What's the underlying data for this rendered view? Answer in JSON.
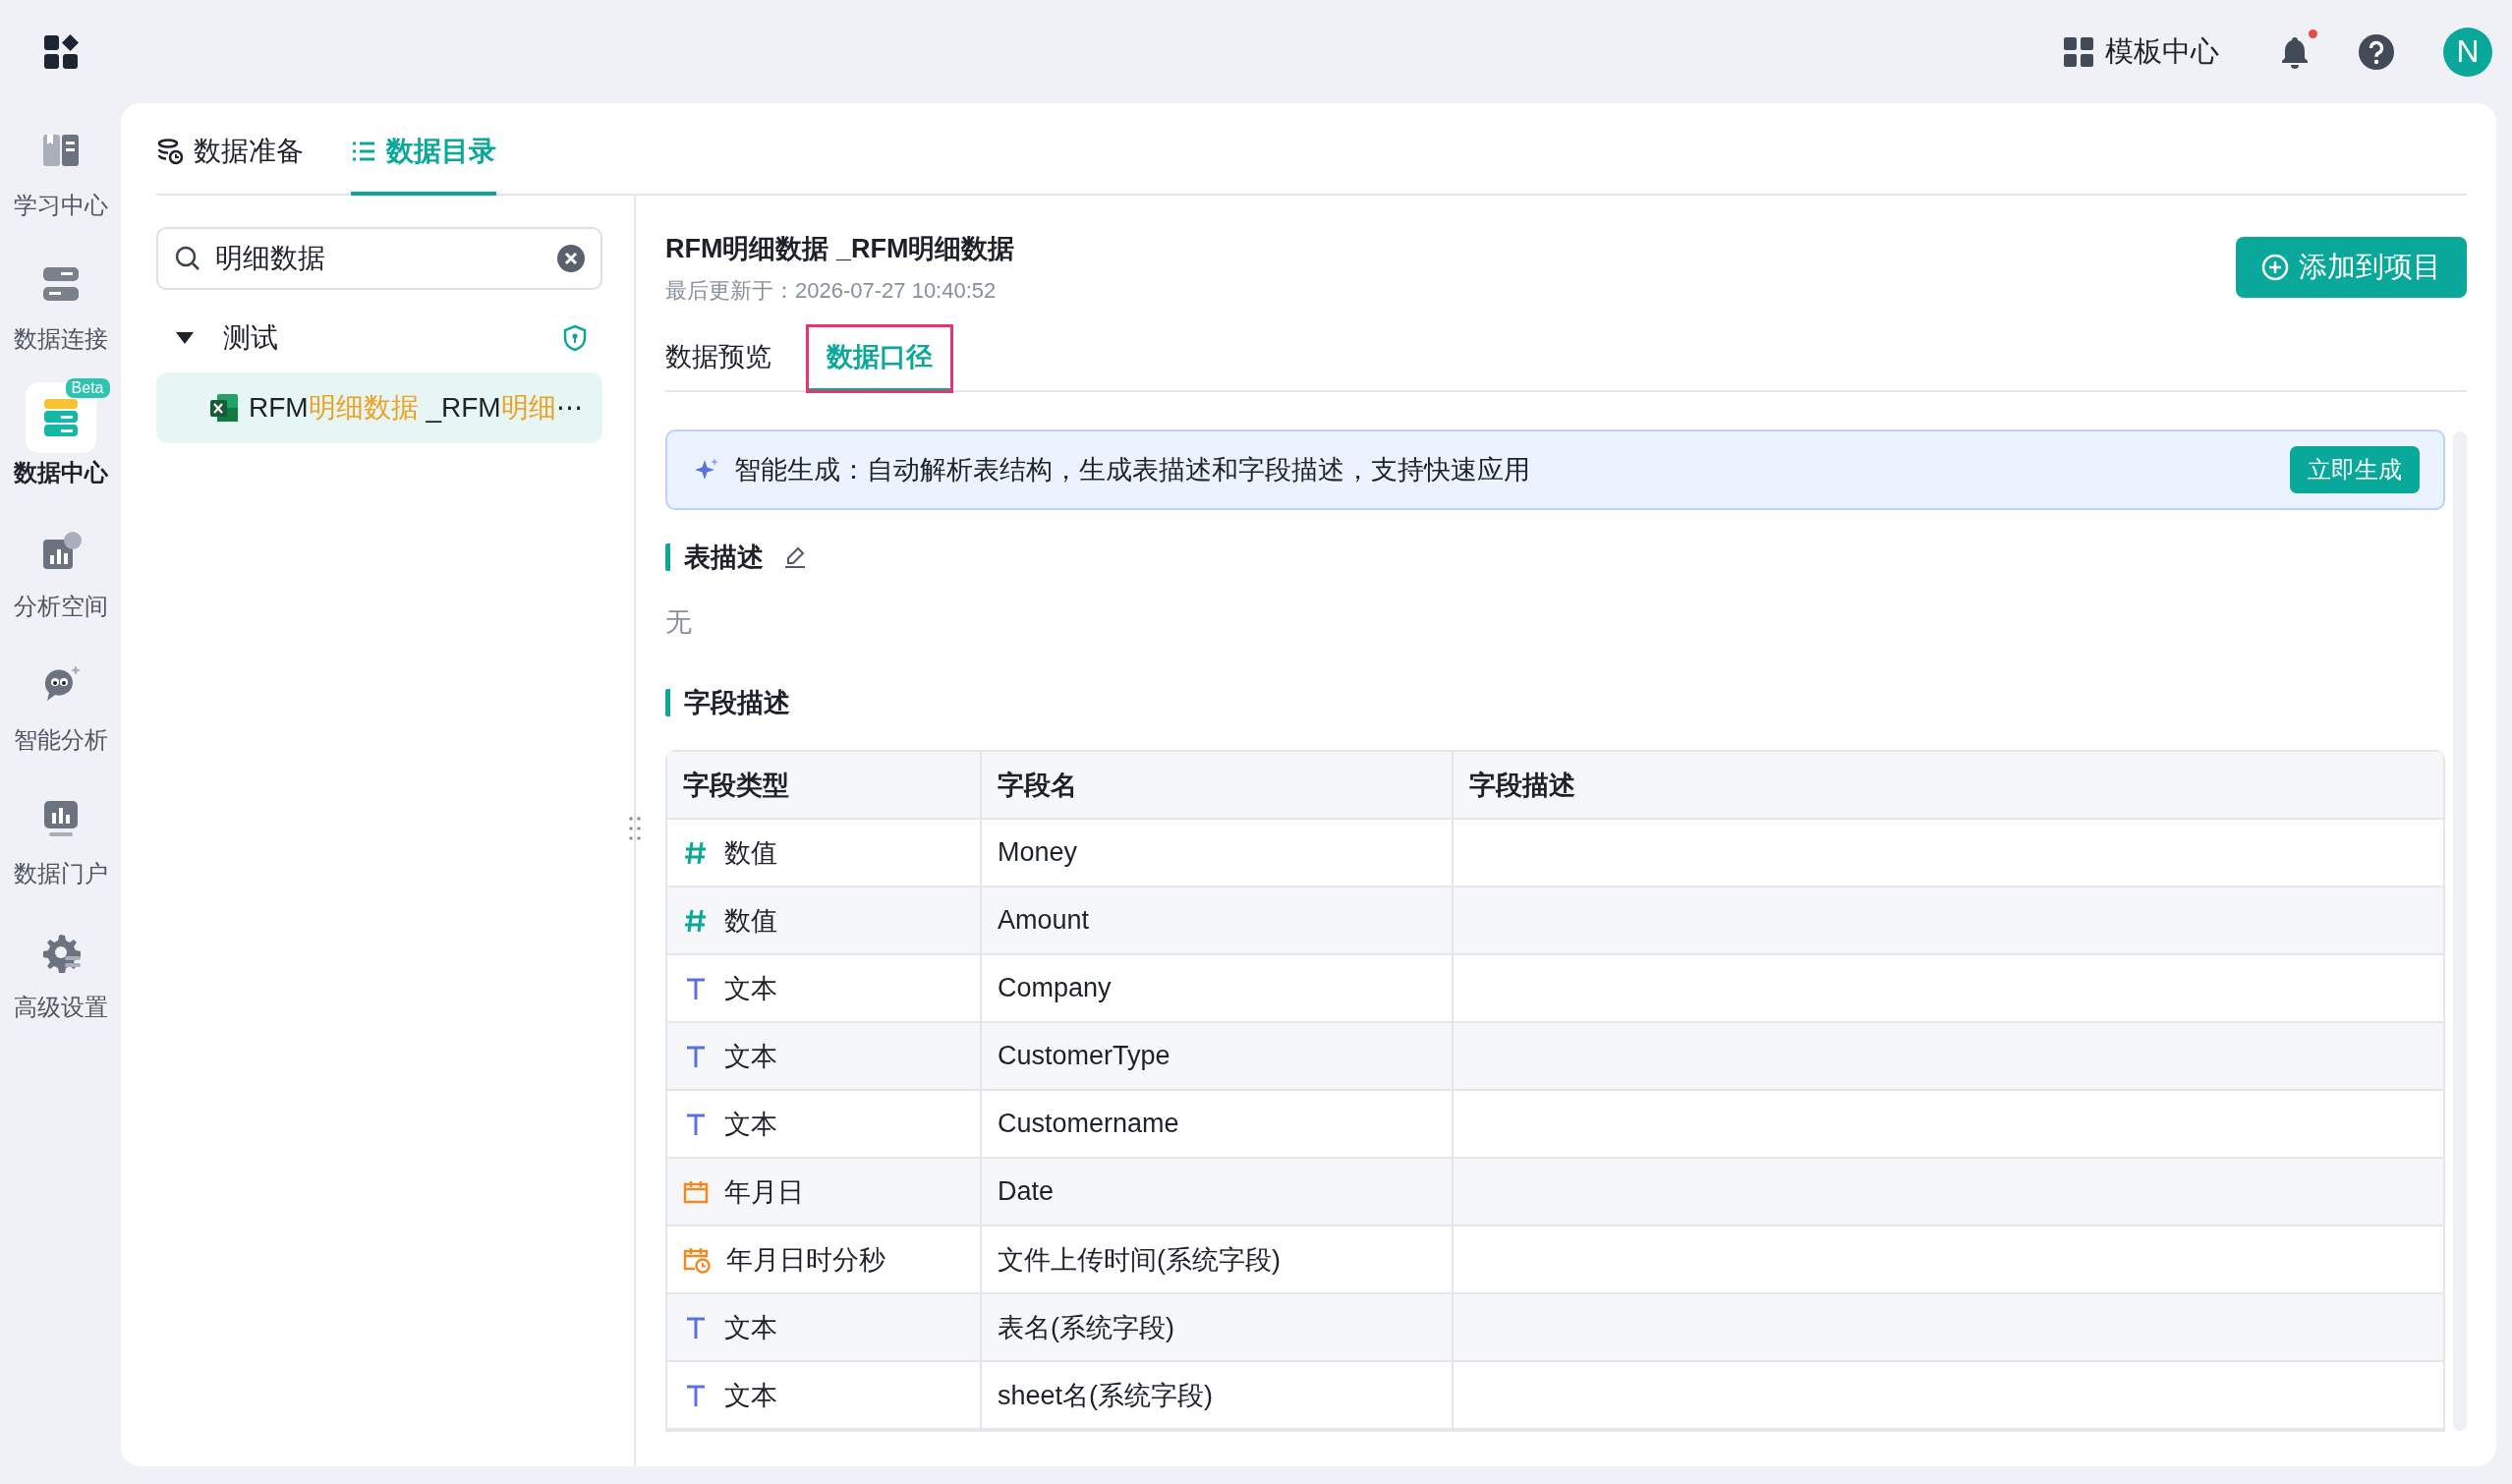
{
  "top_bar": {
    "template_center": "模板中心",
    "notifications_unread": true,
    "avatar": "N"
  },
  "nav": [
    {
      "label": "学习中心",
      "selected": false
    },
    {
      "label": "数据连接",
      "selected": false
    },
    {
      "label": "数据中心",
      "selected": true,
      "badge": "Beta"
    },
    {
      "label": "分析空间",
      "selected": false
    },
    {
      "label": "智能分析",
      "selected": false
    },
    {
      "label": "数据门户",
      "selected": false
    },
    {
      "label": "高级设置",
      "selected": false
    }
  ],
  "tabs": [
    {
      "label": "数据准备",
      "selected": false
    },
    {
      "label": "数据目录",
      "selected": true
    }
  ],
  "search": {
    "value": "明细数据"
  },
  "tree": [
    {
      "label": "测试",
      "expanded": true,
      "children": [
        {
          "segments": [
            {
              "text": "RFM",
              "highlight": false
            },
            {
              "text": "明细数据",
              "highlight": true
            },
            {
              "text": " _RFM",
              "highlight": false
            },
            {
              "text": "明细",
              "highlight": true
            },
            {
              "text": "⋯",
              "highlight": false
            }
          ],
          "selected": true
        }
      ]
    }
  ],
  "detail": {
    "title": "RFM明细数据 _RFM明细数据",
    "updated": "最后更新于：2026-07-27 10:40:52",
    "add_button": "添加到项目",
    "subtabs": [
      {
        "label": "数据预览",
        "selected": false
      },
      {
        "label": "数据口径",
        "selected": true
      }
    ],
    "banner": {
      "text": "智能生成：自动解析表结构，生成表描述和字段描述，支持快速应用",
      "button": "立即生成"
    },
    "table_description": {
      "heading": "表描述",
      "value": "无"
    },
    "field_section": "字段描述",
    "table": {
      "columns": [
        "字段类型",
        "字段名",
        "字段描述"
      ],
      "rows": [
        {
          "kind": "number",
          "type": "数值",
          "name": "Money"
        },
        {
          "kind": "number",
          "type": "数值",
          "name": "Amount"
        },
        {
          "kind": "text",
          "type": "文本",
          "name": "Company"
        },
        {
          "kind": "text",
          "type": "文本",
          "name": "CustomerType"
        },
        {
          "kind": "text",
          "type": "文本",
          "name": "Customername"
        },
        {
          "kind": "date",
          "type": "年月日",
          "name": "Date"
        },
        {
          "kind": "datetime",
          "type": "年月日时分秒",
          "name": "文件上传时间(系统字段)"
        },
        {
          "kind": "text",
          "type": "文本",
          "name": "表名(系统字段)"
        },
        {
          "kind": "text",
          "type": "文本",
          "name": "sheet名(系统字段)"
        }
      ]
    }
  }
}
